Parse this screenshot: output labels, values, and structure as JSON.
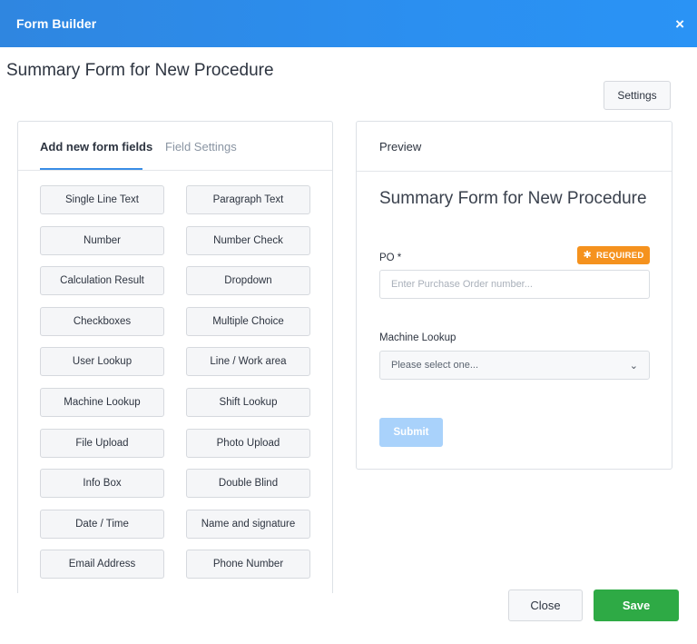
{
  "header": {
    "title": "Form Builder",
    "close_icon": "×"
  },
  "page_title": "Summary Form for New Procedure",
  "settings_label": "Settings",
  "tabs": [
    {
      "label": "Add new form fields",
      "active": true
    },
    {
      "label": "Field Settings",
      "active": false
    }
  ],
  "fields": [
    [
      "Single Line Text",
      "Paragraph Text"
    ],
    [
      "Number",
      "Number Check"
    ],
    [
      "Calculation Result",
      "Dropdown"
    ],
    [
      "Checkboxes",
      "Multiple Choice"
    ],
    [
      "User Lookup",
      "Line / Work area"
    ],
    [
      "Machine Lookup",
      "Shift Lookup"
    ],
    [
      "File Upload",
      "Photo Upload"
    ],
    [
      "Info Box",
      "Double Blind"
    ],
    [
      "Date / Time",
      "Name and signature"
    ],
    [
      "Email Address",
      "Phone Number"
    ]
  ],
  "preview": {
    "heading": "Preview",
    "form_title": "Summary Form for New Procedure",
    "po_label": "PO *",
    "required_badge": "REQUIRED",
    "required_icon": "✱",
    "po_placeholder": "Enter Purchase Order number...",
    "machine_label": "Machine Lookup",
    "machine_select": "Please select one...",
    "submit_label": "Submit"
  },
  "footer": {
    "close_label": "Close",
    "save_label": "Save"
  },
  "colors": {
    "header": "#2b8ff0",
    "accent": "#3a8ee6",
    "required": "#f5921e",
    "save": "#2eaa45",
    "submit_disabled": "#a9d2fb"
  }
}
